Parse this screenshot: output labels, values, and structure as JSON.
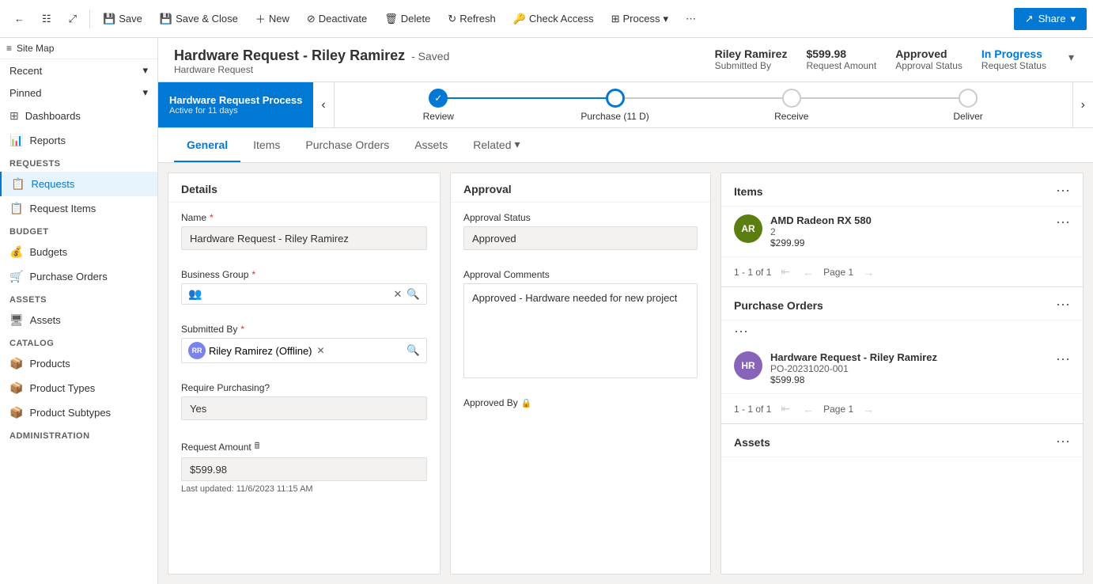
{
  "sitemap": {
    "label": "Site Map"
  },
  "topbar": {
    "back_btn": "←",
    "page_btn": "⊞",
    "expand_btn": "⊡",
    "save_label": "Save",
    "save_close_label": "Save & Close",
    "new_label": "New",
    "deactivate_label": "Deactivate",
    "delete_label": "Delete",
    "refresh_label": "Refresh",
    "check_access_label": "Check Access",
    "process_label": "Process",
    "more_label": "⋯",
    "share_label": "Share"
  },
  "sidebar": {
    "recent_label": "Recent",
    "pinned_label": "Pinned",
    "dashboards_label": "Dashboards",
    "reports_label": "Reports",
    "requests_group": "Requests",
    "requests_label": "Requests",
    "request_items_label": "Request Items",
    "budget_group": "Budget",
    "budgets_label": "Budgets",
    "purchase_orders_label": "Purchase Orders",
    "assets_group": "Assets",
    "assets_label": "Assets",
    "catalog_group": "Catalog",
    "products_label": "Products",
    "product_types_label": "Product Types",
    "product_subtypes_label": "Product Subtypes",
    "administration_group": "Administration"
  },
  "record": {
    "title": "Hardware Request - Riley Ramirez",
    "saved_indicator": "- Saved",
    "subtitle": "Hardware Request",
    "submitted_by_label": "Submitted By",
    "submitted_by_value": "Riley Ramirez",
    "request_amount_label": "Request Amount",
    "request_amount_value": "$599.98",
    "approval_status_label": "Approval Status",
    "approval_status_value": "Approved",
    "request_status_label": "Request Status",
    "request_status_value": "In Progress"
  },
  "process_bar": {
    "title": "Hardware Request Process",
    "subtitle": "Active for 11 days",
    "steps": [
      {
        "label": "Review",
        "state": "completed"
      },
      {
        "label": "Purchase  (11 D)",
        "state": "active"
      },
      {
        "label": "Receive",
        "state": "inactive"
      },
      {
        "label": "Deliver",
        "state": "inactive"
      }
    ]
  },
  "tabs": [
    {
      "label": "General",
      "active": true
    },
    {
      "label": "Items",
      "active": false
    },
    {
      "label": "Purchase Orders",
      "active": false
    },
    {
      "label": "Assets",
      "active": false
    },
    {
      "label": "Related",
      "active": false,
      "has_chevron": true
    }
  ],
  "details_panel": {
    "title": "Details",
    "name_label": "Name",
    "name_value": "Hardware Request - Riley Ramirez",
    "business_group_label": "Business Group",
    "business_group_placeholder": "",
    "submitted_by_label": "Submitted By",
    "submitted_by_person": "Riley Ramirez (Offline)",
    "require_purchasing_label": "Require Purchasing?",
    "require_purchasing_value": "Yes",
    "request_amount_label": "Request Amount",
    "request_amount_value": "$599.98",
    "last_updated": "Last updated:",
    "last_updated_date": "11/6/2023 11:15 AM"
  },
  "approval_panel": {
    "title": "Approval",
    "approval_status_label": "Approval Status",
    "approval_status_value": "Approved",
    "approval_comments_label": "Approval Comments",
    "approval_comments_value": "Approved - Hardware needed for new project",
    "approved_by_label": "Approved By"
  },
  "items_panel": {
    "title": "Items",
    "items": [
      {
        "initials": "AR",
        "bg_color": "#5c7e10",
        "name": "AMD Radeon RX 580",
        "quantity": "2",
        "price": "$299.99"
      }
    ],
    "pagination": "1 - 1 of 1",
    "page_label": "Page 1"
  },
  "purchase_orders_panel": {
    "title": "Purchase Orders",
    "orders": [
      {
        "initials": "HR",
        "bg_color": "#8764b8",
        "name": "Hardware Request - Riley Ramirez",
        "po_number": "PO-20231020-001",
        "amount": "$599.98"
      }
    ],
    "pagination": "1 - 1 of 1",
    "page_label": "Page 1"
  }
}
